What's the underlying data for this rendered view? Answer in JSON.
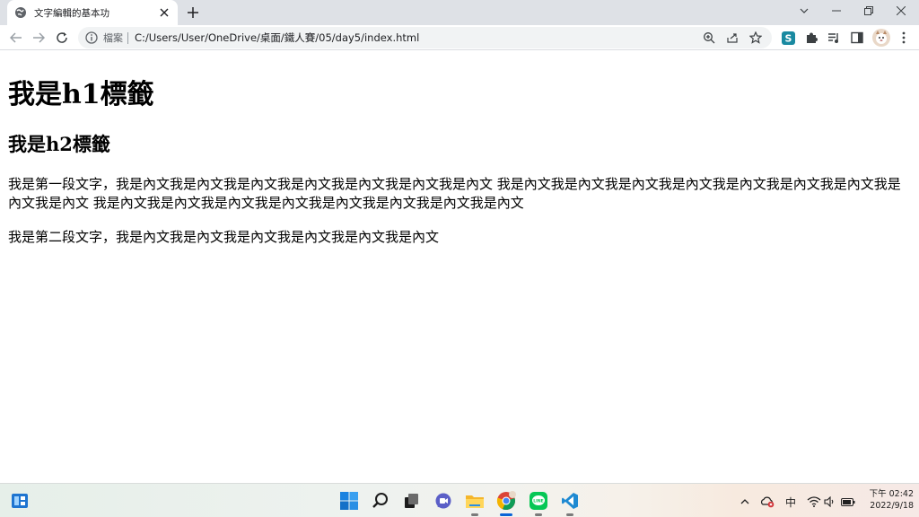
{
  "browser": {
    "tab_title": "文字編輯的基本功",
    "omnibox": {
      "info_label": "檔案",
      "url": "C:/Users/User/OneDrive/桌面/鐵人賽/05/day5/index.html"
    },
    "toolbar_icons": [
      "back-icon",
      "forward-icon",
      "reload-icon",
      "zoom-icon",
      "share-icon",
      "bookmark-star-icon",
      "extension-s-icon",
      "extensions-puzzle-icon",
      "reading-list-icon",
      "side-panel-icon",
      "profile-avatar",
      "menu-kebab-icon"
    ],
    "extension_badge": "S"
  },
  "page": {
    "h1": "我是h1標籤",
    "h2": "我是h2標籤",
    "paragraph1": "我是第一段文字，我是內文我是內文我是內文我是內文我是內文我是內文我是內文 我是內文我是內文我是內文我是內文我是內文我是內文我是內文我是內文我是內文 我是內文我是內文我是內文我是內文我是內文我是內文我是內文我是內文",
    "paragraph2": "我是第二段文字，我是內文我是內文我是內文我是內文我是內文我是內文"
  },
  "taskbar": {
    "apps": [
      "widgets-icon",
      "start-windows-icon",
      "search-icon",
      "task-view-icon",
      "chat-icon",
      "file-explorer-icon",
      "chrome-icon",
      "line-icon",
      "vscode-icon"
    ],
    "ime": "中",
    "time": "下午 02:42",
    "date": "2022/9/18"
  },
  "colors": {
    "tabstrip_bg": "#dee1e6",
    "omnibox_bg": "#f1f3f4",
    "accent_blue": "#0a64d6"
  }
}
